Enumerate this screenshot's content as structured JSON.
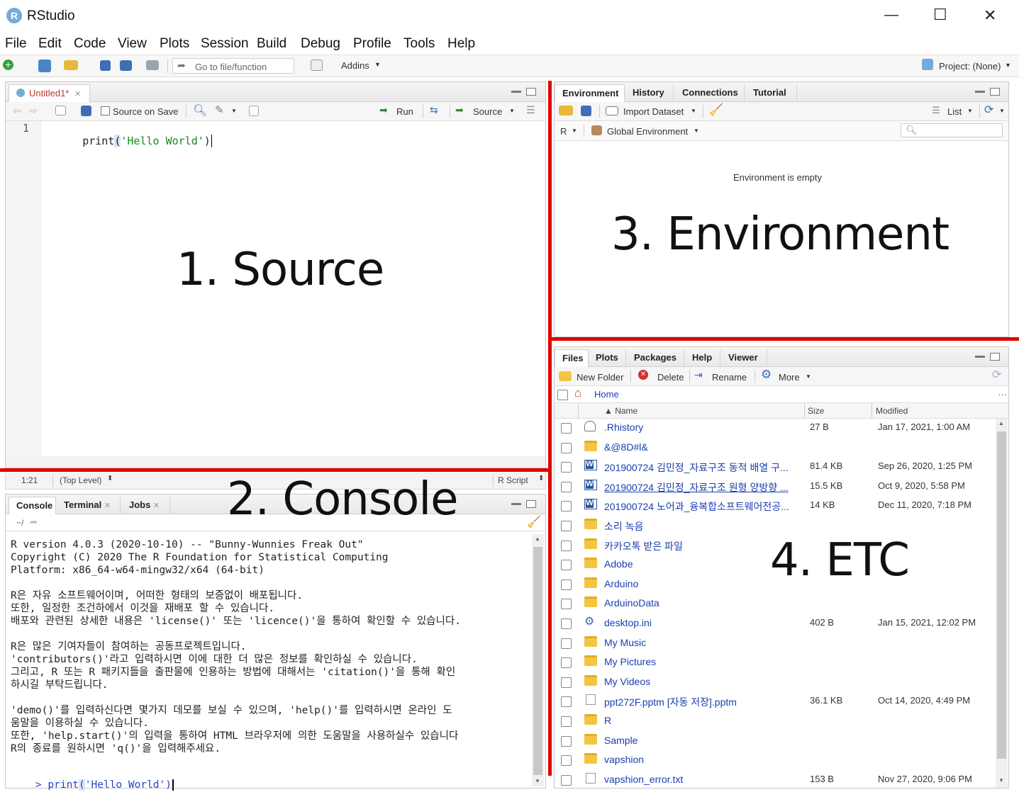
{
  "window": {
    "title": "RStudio",
    "controls": [
      "—",
      "☐",
      "✕"
    ]
  },
  "menu": [
    "File",
    "Edit",
    "Code",
    "View",
    "Plots",
    "Session",
    "Build",
    "Debug",
    "Profile",
    "Tools",
    "Help"
  ],
  "toolbar": {
    "goto_placeholder": "Go to file/function",
    "addins": "Addins",
    "project": "Project: (None)"
  },
  "source": {
    "tab": "Untitled1*",
    "source_on_save": "Source on Save",
    "run": "Run",
    "source_btn": "Source",
    "line_no": "1",
    "code_fn": "print",
    "code_open": "(",
    "code_str": "'Hello World'",
    "code_close": ")",
    "status_pos": "1:21",
    "status_scope": "(Top Level)",
    "status_type": "R Script"
  },
  "console": {
    "tabs": [
      "Console",
      "Terminal",
      "Jobs"
    ],
    "path": "~/",
    "lines": [
      "R version 4.0.3 (2020-10-10) -- \"Bunny-Wunnies Freak Out\"",
      "Copyright (C) 2020 The R Foundation for Statistical Computing",
      "Platform: x86_64-w64-mingw32/x64 (64-bit)",
      "",
      "R은 자유 소프트웨어이며, 어떠한 형태의 보증없이 배포됩니다.",
      "또한, 일정한 조건하에서 이것을 재배포 할 수 있습니다.",
      "배포와 관련된 상세한 내용은 'license()' 또는 'licence()'을 통하여 확인할 수 있습니다.",
      "",
      "R은 많은 기여자들이 참여하는 공동프로젝트입니다.",
      "'contributors()'라고 입력하시면 이에 대한 더 많은 정보를 확인하실 수 있습니다.",
      "그리고, R 또는 R 패키지들을 출판물에 인용하는 방법에 대해서는 'citation()'을 통해 확인",
      "하시길 부탁드립니다.",
      "",
      "'demo()'를 입력하신다면 몇가지 데모를 보실 수 있으며, 'help()'를 입력하시면 온라인 도",
      "움말을 이용하실 수 있습니다.",
      "또한, 'help.start()'의 입력을 통하여 HTML 브라우저에 의한 도움말을 사용하실수 있습니다",
      "R의 종료를 원하시면 'q()'을 입력해주세요."
    ],
    "prompt": ">",
    "input_fn": "print",
    "input_open": "(",
    "input_str": "'Hello World'",
    "input_close": ")"
  },
  "environment": {
    "tabs": [
      "Environment",
      "History",
      "Connections",
      "Tutorial"
    ],
    "import_dataset": "Import Dataset",
    "list": "List",
    "lang": "R",
    "scope": "Global Environment",
    "empty_msg": "Environment is empty"
  },
  "files": {
    "tabs": [
      "Files",
      "Plots",
      "Packages",
      "Help",
      "Viewer"
    ],
    "new_folder": "New Folder",
    "delete": "Delete",
    "rename": "Rename",
    "more": "More",
    "breadcrumb": "Home",
    "col_name": "▲ Name",
    "col_size": "Size",
    "col_modified": "Modified",
    "rows": [
      {
        "icon": "history-file-icon",
        "name": ".Rhistory",
        "size": "27 B",
        "modified": "Jan 17, 2021, 1:00 AM"
      },
      {
        "icon": "folder-icon",
        "name": "&@8D#l&",
        "size": "",
        "modified": ""
      },
      {
        "icon": "word-doc-icon",
        "name": "201900724 김민정_자료구조 동적 배열 구...",
        "size": "81.4 KB",
        "modified": "Sep 26, 2020, 1:25 PM"
      },
      {
        "icon": "word-doc-icon",
        "name": "201900724 김민정_자료구조 원형 양방향 ...",
        "size": "15.5 KB",
        "modified": "Oct 9, 2020, 5:58 PM"
      },
      {
        "icon": "word-doc-icon",
        "name": "201900724 노어과_융복합소프트웨어전공...",
        "size": "14 KB",
        "modified": "Dec 11, 2020, 7:18 PM"
      },
      {
        "icon": "folder-icon",
        "name": "소리 녹음",
        "size": "",
        "modified": ""
      },
      {
        "icon": "folder-icon",
        "name": "카카오톡 받은 파일",
        "size": "",
        "modified": ""
      },
      {
        "icon": "folder-icon",
        "name": "Adobe",
        "size": "",
        "modified": ""
      },
      {
        "icon": "folder-icon",
        "name": "Arduino",
        "size": "",
        "modified": ""
      },
      {
        "icon": "folder-icon",
        "name": "ArduinoData",
        "size": "",
        "modified": ""
      },
      {
        "icon": "settings-file-icon",
        "name": "desktop.ini",
        "size": "402 B",
        "modified": "Jan 15, 2021, 12:02 PM"
      },
      {
        "icon": "folder-icon",
        "name": "My Music",
        "size": "",
        "modified": ""
      },
      {
        "icon": "folder-icon",
        "name": "My Pictures",
        "size": "",
        "modified": ""
      },
      {
        "icon": "folder-icon",
        "name": "My Videos",
        "size": "",
        "modified": ""
      },
      {
        "icon": "file-icon",
        "name": "ppt272F.pptm [자동 저장].pptm",
        "size": "36.1 KB",
        "modified": "Oct 14, 2020, 4:49 PM"
      },
      {
        "icon": "folder-icon",
        "name": "R",
        "size": "",
        "modified": ""
      },
      {
        "icon": "folder-icon",
        "name": "Sample",
        "size": "",
        "modified": ""
      },
      {
        "icon": "folder-icon",
        "name": "vapshion",
        "size": "",
        "modified": ""
      },
      {
        "icon": "file-icon",
        "name": "vapshion_error.txt",
        "size": "153 B",
        "modified": "Nov 27, 2020, 9:06 PM"
      }
    ]
  },
  "annotations": {
    "source": "1. Source",
    "console": "2. Console",
    "environment": "3. Environment",
    "etc": "4. ETC",
    "line_color": "#e00000"
  }
}
